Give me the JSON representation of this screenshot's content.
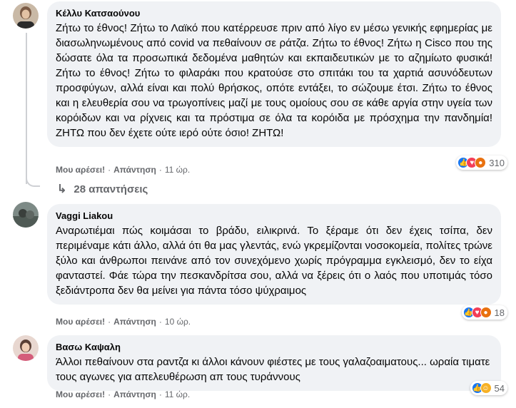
{
  "comments": [
    {
      "author": "Κέλλυ Κατσαούνου",
      "text": "Ζήτω το έθνος! Ζήτω το Λαϊκό που κατέρρευσε πριν από λίγο εν μέσω γενικής εφημερίας με διασωληνωμένους από covid να πεθαίνουν σε ράτζα. Ζήτω το έθνος! Ζήτω η Cisco που της δώσατε όλα τα προσωπικά δεδομένα μαθητών και εκπαιδευτικών με το αζημίωτο φυσικά! Ζήτω το έθνος! Ζήτω το φιλαράκι που κρατούσε στο σπιτάκι του τα χαρτιά ασυνόδευτων προσφύγων, αλλά είναι και πολύ θρήσκος, οπότε εντάξει, το σώζουμε έτσι. Ζήτω το έθνος και η ελευθερία σου να τρωγοπίνεις μαζί με τους ομοίους σου σε κάθε αργία στην υγεία των κορόιδων και να ρίχνεις και τα πρόστιμα σε όλα τα κορόιδα με πρόσχημα την πανδημία! ΖΗΤΩ που δεν έχετε ούτε ιερό ούτε όσιο! ΖΗΤΩ!",
      "like_label": "Μου αρέσει!",
      "reply_label": "Απάντηση",
      "time": "11 ώρ.",
      "reaction_count": "310",
      "reactions": [
        "like",
        "love",
        "angry"
      ]
    },
    {
      "author": "Vaggi Liakou",
      "text": "Αναρωτιέμαι πώς κοιμάσαι το βράδυ, ειλικρινά. Το ξέραμε ότι δεν έχεις τσίπα, δεν περιμέναμε κάτι άλλο, αλλά ότι θα μας γλεντάς, ενώ γκρεμίζονται νοσοκομεία, πολίτες τρώνε ξύλο και άνθρωποι πεινάνε από τον συνεχόμενο χωρίς πρόγραμμα εγκλεισμό, δεν το είχα φανταστεί. Φάε τώρα την πεσκανδρίτσα σου, αλλά να ξέρεις ότι ο λαός που υποτιμάς τόσο ξεδιάντροπα δεν θα μείνει για πάντα τόσο ψύχραιμος",
      "like_label": "Μου αρέσει!",
      "reply_label": "Απάντηση",
      "time": "10 ώρ.",
      "reaction_count": "18",
      "reactions": [
        "like",
        "love",
        "angry"
      ]
    },
    {
      "author": "Βασω Καψαλη",
      "text": "Άλλοι πεθαίνουν στα ραντζα κι άλλοι κάνουν φιέστες με τους γαλαζοαιματους... ωραία τιματε τους αγωνες για απελευθέρωση απ τους τυράννους",
      "like_label": "Μου αρέσει!",
      "reply_label": "Απάντηση",
      "time": "11 ώρ.",
      "reaction_count": "54",
      "reactions": [
        "like",
        "laugh"
      ]
    }
  ],
  "replies_label": "28 απαντήσεις",
  "colors": {
    "bubble": "#f0f2f5",
    "meta": "#65676b",
    "like": "#1877f2",
    "love": "#f33e58",
    "angry": "#e9710f"
  }
}
